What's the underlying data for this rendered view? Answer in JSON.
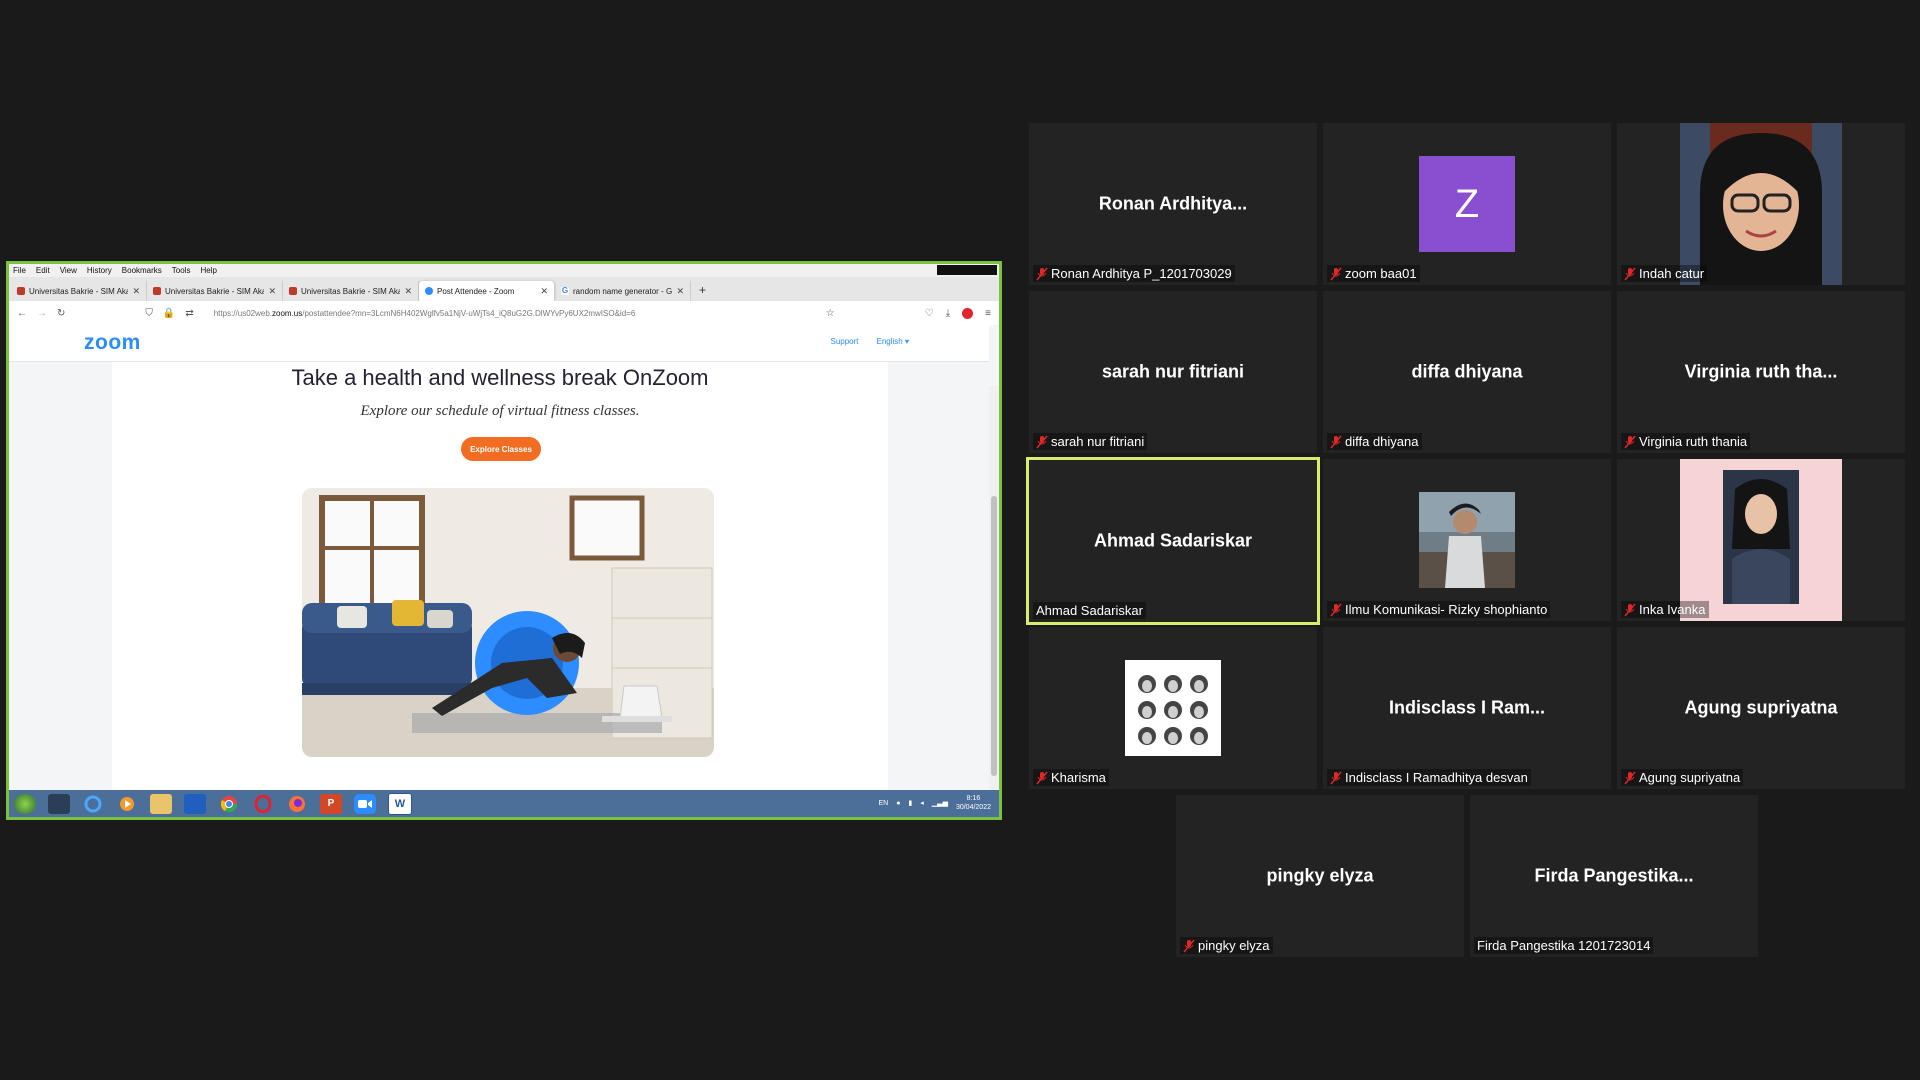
{
  "browser": {
    "menu": [
      "File",
      "Edit",
      "View",
      "History",
      "Bookmarks",
      "Tools",
      "Help"
    ],
    "tabs": [
      {
        "label": "Universitas Bakrie - SIM Akade",
        "favicon": "#c0392b"
      },
      {
        "label": "Universitas Bakrie - SIM Akade",
        "favicon": "#c0392b"
      },
      {
        "label": "Universitas Bakrie - SIM Akade",
        "favicon": "#c0392b"
      },
      {
        "label": "Post Attendee - Zoom",
        "favicon": "#2d8cff",
        "active": true
      },
      {
        "label": "random name generator - Goo",
        "favicon": "#4285f4"
      }
    ],
    "new_tab": "+",
    "url_prefix": "https://us02web.",
    "url_domain": "zoom.us",
    "url_rest": "/postattendee?mn=3LcmN6H402Wglfv5a1NjV-uWjTs4_iQ8uG2G.DlWYvPy6UX2mwISO&id=6"
  },
  "zoom_page": {
    "logo": "zoom",
    "support": "Support",
    "language": "English ▾",
    "headline": "Take a health and wellness break OnZoom",
    "subline": "Explore our schedule of virtual fitness classes.",
    "cta": "Explore Classes"
  },
  "taskbar": {
    "lang": "EN",
    "time": "8:16",
    "date": "30/04/2022"
  },
  "participants": [
    {
      "display": "Ronan  Ardhitya...",
      "label": "Ronan Ardhitya P_1201703029",
      "muted": true,
      "type": "name"
    },
    {
      "display": "Z",
      "label": "zoom baa01",
      "muted": true,
      "type": "avatar"
    },
    {
      "display": "",
      "label": "Indah catur",
      "muted": true,
      "type": "photo-indah"
    },
    {
      "display": "sarah nur fitriani",
      "label": "sarah nur fitriani",
      "muted": true,
      "type": "name"
    },
    {
      "display": "diffa dhiyana",
      "label": "diffa dhiyana",
      "muted": true,
      "type": "name"
    },
    {
      "display": "Virginia ruth tha...",
      "label": "Virginia ruth thania",
      "muted": true,
      "type": "name"
    },
    {
      "display": "Ahmad Sadariskar",
      "label": "Ahmad Sadariskar",
      "muted": false,
      "type": "name",
      "active": true
    },
    {
      "display": "",
      "label": "Ilmu Komunikasi- Rizky shophianto",
      "muted": true,
      "type": "photo-rizky"
    },
    {
      "display": "",
      "label": "Inka Ivanka",
      "muted": true,
      "type": "photo-inka"
    },
    {
      "display": "",
      "label": "Kharisma",
      "muted": true,
      "type": "photo-kharisma"
    },
    {
      "display": "Indisclass I Ram...",
      "label": "Indisclass I Ramadhitya desvan",
      "muted": true,
      "type": "name"
    },
    {
      "display": "Agung supriyatna",
      "label": "Agung supriyatna",
      "muted": true,
      "type": "name"
    },
    {
      "display": "pingky elyza",
      "label": "pingky elyza",
      "muted": true,
      "type": "name"
    },
    {
      "display": "Firda  Pangestika...",
      "label": "Firda Pangestika 1201723014",
      "muted": false,
      "type": "name"
    }
  ],
  "colors": {
    "share_border": "#7cc242",
    "active_speaker": "#d6ee6b",
    "mute_red": "#e02828",
    "zoom_blue": "#2d8cff",
    "cta_orange": "#f26d21"
  }
}
